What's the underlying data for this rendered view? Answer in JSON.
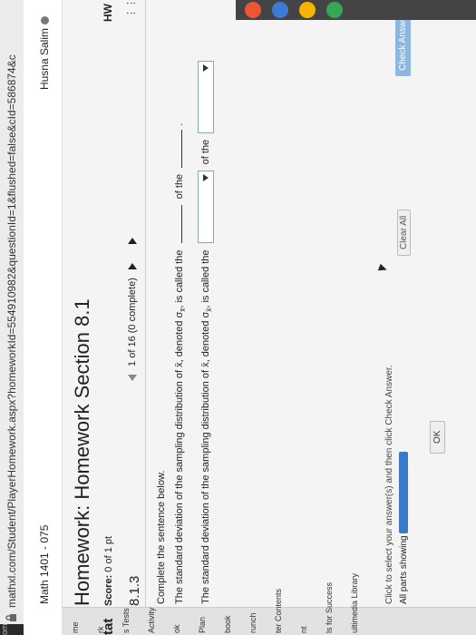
{
  "address_bar": {
    "clip_left": "om",
    "url": "mathxl.com/Student/PlayerHomework.aspx?homeworkId=554910982&questionId=1&flushed=false&cId=586874&c"
  },
  "header": {
    "course": "Math 1401 - 075",
    "user": "Husna Salim"
  },
  "left_nav": [
    "me",
    "rk",
    "s Tests",
    "Activity",
    "ok",
    "Plan",
    "book",
    "runch",
    "ter Contents",
    "nt",
    "ls for Success",
    "ultimedia Library"
  ],
  "title": "Homework: Homework Section 8.1",
  "stat_label": "tat",
  "score": {
    "label": "Score:",
    "value": "0 of 1 pt"
  },
  "hw_tag": "HW",
  "question_number": "8.1.3",
  "question_nav": {
    "text": "1 of 16 (0 complete)"
  },
  "question": {
    "instruction": "Complete the sentence below.",
    "sentence1_a": "The standard deviation of the sampling distribution of x̄, denoted σ",
    "sentence1_sub": "x̄",
    "sentence1_b": ", is called the",
    "sentence1_c": "of the",
    "sentence1_end": ".",
    "sentence2_a": "The standard deviation of the sampling distribution of x̄, denoted σ",
    "sentence2_sub": "x̄",
    "sentence2_b": ", is called the",
    "sentence2_c": "of the"
  },
  "footer": {
    "hint": "Click to select your answer(s) and then click Check Answer.",
    "parts": "All parts showing",
    "clear_all": "Clear All",
    "check_answer": "Check Answer",
    "ok": "OK"
  }
}
